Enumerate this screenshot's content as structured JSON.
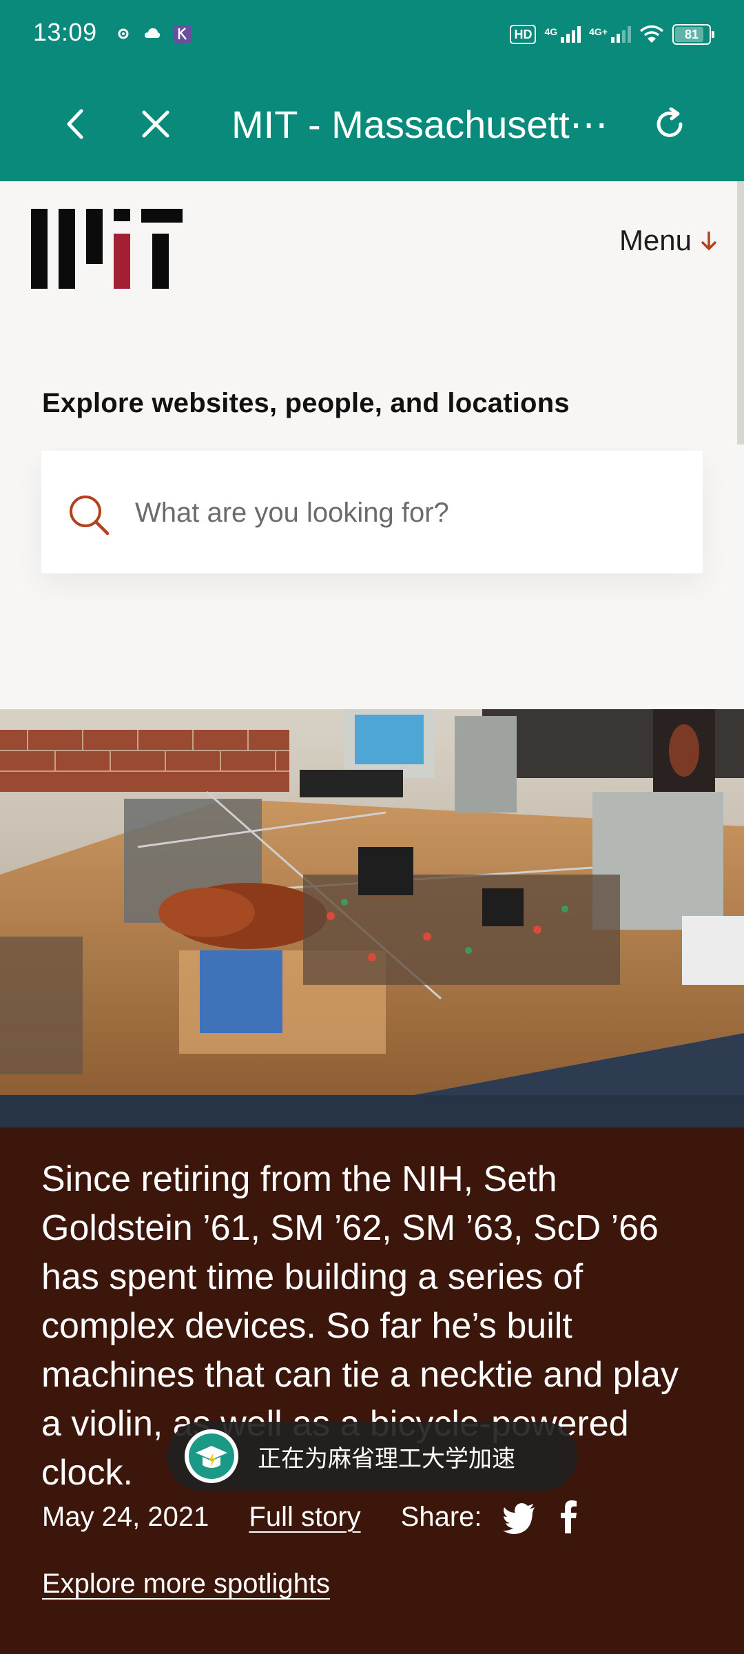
{
  "status_bar": {
    "time": "13:09",
    "hd_label": "HD",
    "net1": "4G",
    "net2": "4G+",
    "battery": "81"
  },
  "browser": {
    "title": "MIT - Massachusett⋯"
  },
  "page": {
    "menu_label": "Menu",
    "explore_heading": "Explore websites, people, and locations",
    "search_placeholder": "What are you looking for?"
  },
  "spotlight": {
    "text": "Since retiring from the NIH, Seth Goldstein ’61, SM ’62, SM ’63, ScD ’66 has spent time building a series of complex devices. So far he’s built machines that can tie a necktie and play a violin, as well as a bicycle-powered clock.",
    "date": "May 24, 2021",
    "full_story": "Full story",
    "share_label": "Share:",
    "explore_more": "Explore more spotlights"
  },
  "toast": {
    "text": "正在为麻省理工大学加速"
  },
  "colors": {
    "header": "#0a8a7b",
    "spotlight_bg": "#3d160b",
    "mit_red": "#a31f34",
    "accent_orange": "#b5401d"
  }
}
